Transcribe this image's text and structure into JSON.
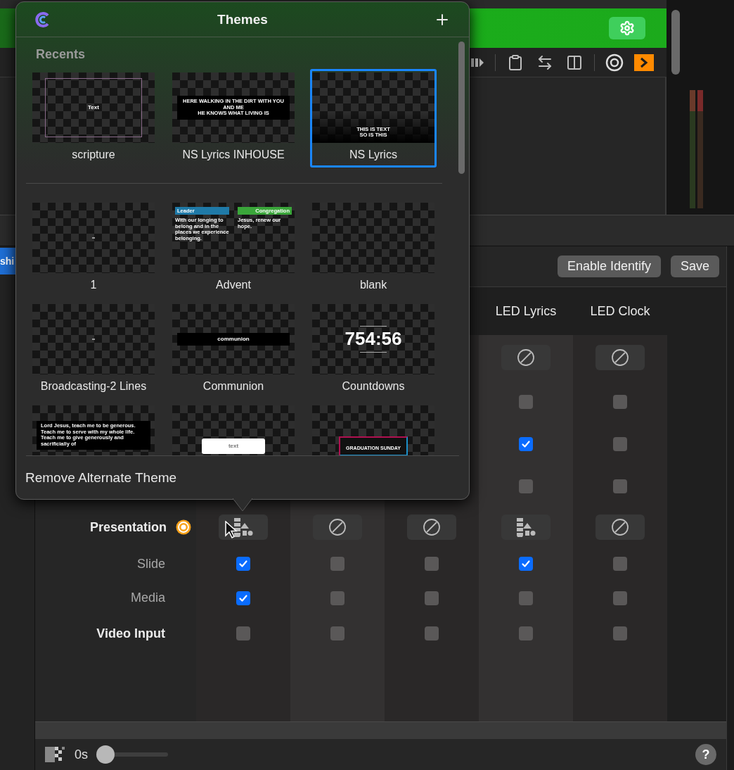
{
  "side_tab": {
    "label": "shi",
    "selected": true
  },
  "actions": [
    "Enable Identify",
    "Save"
  ],
  "screens": {
    "columns": [
      {
        "name": "LED Lyrics"
      },
      {
        "name": "LED Clock"
      }
    ],
    "rows": [
      {
        "cells": [
          {
            "kind": "none"
          },
          {
            "kind": "none"
          }
        ]
      },
      {
        "cells": [
          {
            "kind": "checkbox",
            "checked": false
          },
          {
            "kind": "checkbox",
            "checked": false
          }
        ]
      },
      {
        "cells": [
          {
            "kind": "checkbox",
            "checked": true
          },
          {
            "kind": "checkbox",
            "checked": false
          }
        ]
      },
      {
        "cells": [
          {
            "kind": "checkbox",
            "checked": false
          },
          {
            "kind": "checkbox",
            "checked": false
          }
        ]
      },
      {
        "label": "Presentation",
        "kind": "layer",
        "cells": [
          {
            "kind": "theme"
          },
          {
            "kind": "none"
          },
          {
            "kind": "none"
          },
          {
            "kind": "theme"
          },
          {
            "kind": "none"
          }
        ]
      },
      {
        "label": "Slide",
        "kind": "item",
        "cells": [
          {
            "kind": "checkbox",
            "checked": true
          },
          {
            "kind": "checkbox",
            "checked": false
          },
          {
            "kind": "checkbox",
            "checked": false
          },
          {
            "kind": "checkbox",
            "checked": true
          },
          {
            "kind": "checkbox",
            "checked": false
          }
        ]
      },
      {
        "label": "Media",
        "kind": "item",
        "cells": [
          {
            "kind": "checkbox",
            "checked": true
          },
          {
            "kind": "checkbox",
            "checked": false
          },
          {
            "kind": "checkbox",
            "checked": false
          },
          {
            "kind": "checkbox",
            "checked": false
          },
          {
            "kind": "checkbox",
            "checked": false
          }
        ]
      },
      {
        "label": "Video Input",
        "kind": "input",
        "cells": [
          {
            "kind": "checkbox",
            "checked": false
          },
          {
            "kind": "checkbox",
            "checked": false
          },
          {
            "kind": "checkbox",
            "checked": false
          },
          {
            "kind": "checkbox",
            "checked": false
          },
          {
            "kind": "checkbox",
            "checked": false
          }
        ]
      }
    ]
  },
  "footer": {
    "duration": "0s",
    "slider": {
      "level": 0
    },
    "help": "?"
  },
  "themes_popover": {
    "title": "Themes",
    "recents_heading": "Recents",
    "recents": [
      {
        "name": "scripture",
        "selected": false,
        "preview": {
          "kind": "outline",
          "lines": [
            "Text"
          ]
        }
      },
      {
        "name": "NS Lyrics INHOUSE",
        "selected": false,
        "preview": {
          "kind": "band",
          "lines": [
            "HERE WALKING IN THE DIRT WITH YOU AND ME",
            "HE KNOWS WHAT LIVING IS"
          ]
        }
      },
      {
        "name": "NS Lyrics",
        "selected": true,
        "preview": {
          "kind": "lower",
          "lines": [
            "THIS IS TEXT",
            "SO IS THIS"
          ]
        }
      }
    ],
    "themes": [
      {
        "name": "1",
        "selected": false,
        "preview": {
          "kind": "mark"
        }
      },
      {
        "name": "Advent",
        "selected": false,
        "preview": {
          "kind": "split",
          "lines": [
            "Leader",
            "Congregation",
            "With our longing to belong and in the places we experience belonging.",
            "Jesus, renew our hope."
          ]
        }
      },
      {
        "name": "blank",
        "selected": false,
        "preview": {
          "kind": "empty"
        }
      },
      {
        "name": "Broadcasting-2 Lines",
        "selected": false,
        "preview": {
          "kind": "mark"
        }
      },
      {
        "name": "Communion",
        "selected": false,
        "preview": {
          "kind": "band",
          "lines": [
            "communion"
          ]
        }
      },
      {
        "name": "Countdowns",
        "selected": false,
        "preview": {
          "kind": "clock",
          "lines": [
            "754:56"
          ]
        }
      },
      {
        "selected": false,
        "preview": {
          "kind": "bottom",
          "lines": [
            "Lord Jesus, teach me to be generous. Teach me to serve with my whole life. Teach me to give generously and sacrificially of"
          ]
        }
      },
      {
        "selected": false,
        "preview": {
          "kind": "pill",
          "lines": [
            "text"
          ]
        }
      },
      {
        "selected": false,
        "preview": {
          "kind": "outlined",
          "lines": [
            "GRADUATION SUNDAY"
          ]
        }
      }
    ],
    "action": "Remove Alternate Theme"
  }
}
